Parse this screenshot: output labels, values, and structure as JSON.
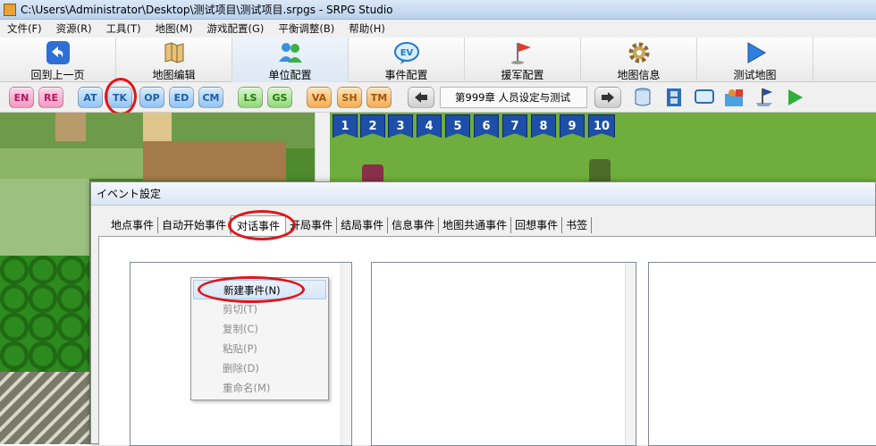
{
  "window": {
    "title": "C:\\Users\\Administrator\\Desktop\\测试项目\\测试项目.srpgs - SRPG Studio"
  },
  "menu": [
    "文件(F)",
    "资源(R)",
    "工具(T)",
    "地图(M)",
    "游戏配置(G)",
    "平衡调整(B)",
    "帮助(H)"
  ],
  "toolbar": [
    {
      "label": "回到上一页",
      "icon": "back-arrow-icon"
    },
    {
      "label": "地图编辑",
      "icon": "map-scroll-icon"
    },
    {
      "label": "单位配置",
      "icon": "units-icon",
      "active": true
    },
    {
      "label": "事件配置",
      "icon": "event-ev-icon"
    },
    {
      "label": "援军配置",
      "icon": "flag-icon"
    },
    {
      "label": "地图信息",
      "icon": "gear-icon"
    },
    {
      "label": "测试地图",
      "icon": "play-icon"
    }
  ],
  "iconbar": {
    "buttons": [
      "EN",
      "RE",
      "AT",
      "TK",
      "OP",
      "ED",
      "CM",
      "LS",
      "GS",
      "VA",
      "SH",
      "TM"
    ],
    "chapter": "第999章 人员设定与测试"
  },
  "map": {
    "flags": [
      "1",
      "2",
      "3",
      "4",
      "5",
      "6",
      "7",
      "8",
      "9",
      "10"
    ]
  },
  "dialog": {
    "title": "イベント設定",
    "tabs": [
      "地点事件",
      "自动开始事件",
      "对话事件",
      "开局事件",
      "结局事件",
      "信息事件",
      "地图共通事件",
      "回想事件",
      "书签"
    ],
    "selected_tab": "对话事件"
  },
  "context_menu": [
    {
      "label": "新建事件(N)",
      "enabled": true
    },
    {
      "label": "剪切(T)",
      "enabled": false
    },
    {
      "label": "复制(C)",
      "enabled": false
    },
    {
      "label": "粘贴(P)",
      "enabled": false
    },
    {
      "label": "删除(D)",
      "enabled": false
    },
    {
      "label": "重命名(M)",
      "enabled": false
    }
  ],
  "colors": {
    "highlight_circle": "#e2141a",
    "flag_blue": "#1d4fa8",
    "grass": "#6fae3c"
  }
}
